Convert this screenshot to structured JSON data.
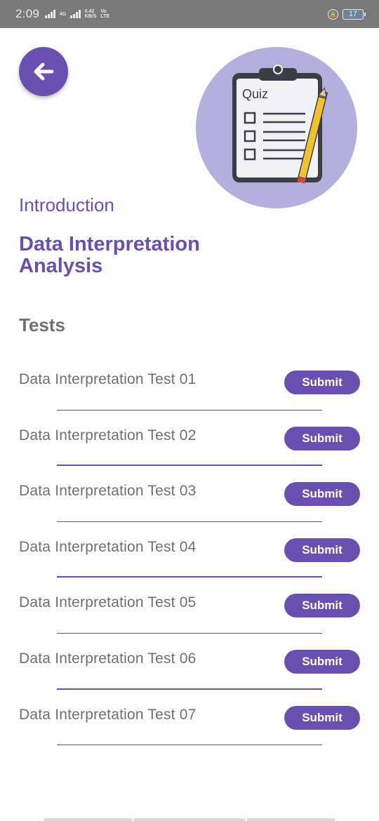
{
  "status_bar": {
    "time": "2:09",
    "network_speed_value": "0.42",
    "network_speed_unit": "KB/S",
    "carrier_top": "Vo",
    "carrier_bottom": "LTE",
    "battery_level": "17",
    "signal_labels": [
      "4G",
      "4G"
    ]
  },
  "illustration": {
    "label": "Quiz",
    "circle_color": "#b4b0de"
  },
  "section": {
    "label": "Introduction"
  },
  "course": {
    "title": "Data Interpretation Analysis"
  },
  "tests": {
    "heading": "Tests",
    "items": [
      {
        "title": "Data Interpretation Test 01",
        "button_label": "Submit"
      },
      {
        "title": "Data Interpretation Test 02",
        "button_label": "Submit"
      },
      {
        "title": "Data Interpretation Test 03",
        "button_label": "Submit"
      },
      {
        "title": "Data Interpretation Test 04",
        "button_label": "Submit"
      },
      {
        "title": "Data Interpretation Test 05",
        "button_label": "Submit"
      },
      {
        "title": "Data Interpretation Test 06",
        "button_label": "Submit"
      },
      {
        "title": "Data Interpretation Test 07",
        "button_label": "Submit"
      }
    ]
  },
  "colors": {
    "accent": "#6a4fb0",
    "status_bar": "#7a7a7a",
    "text_muted": "#6f6f6f"
  },
  "icons": {
    "back": "arrow-left-icon",
    "illustration": "quiz-clipboard-icon"
  }
}
